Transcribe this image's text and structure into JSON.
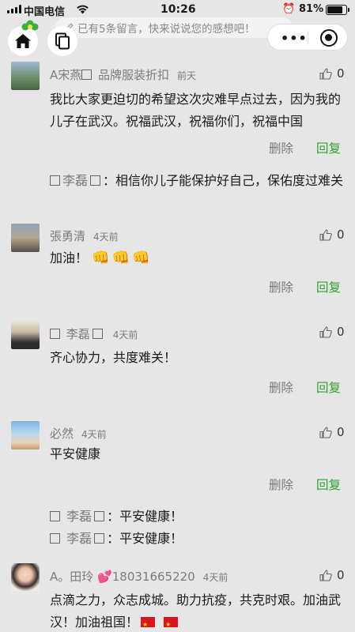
{
  "status_bar": {
    "carrier": "中国电信",
    "time": "10:26",
    "battery": "81%"
  },
  "header": {
    "message_placeholder": "已有5条留言，快来说说您的感想吧！"
  },
  "comments": [
    {
      "name": "A宋燕",
      "name_suffix": " 品牌服装折扣",
      "time": "前天",
      "likes": "0",
      "text": "我比大家更迫切的希望这次灾难早点过去，因为我的儿子在武汉。祝福武汉，祝福你们，祝福中国",
      "delete": "删除",
      "reply": "回复",
      "replies": [
        {
          "name": "李磊",
          "text": "：相信你儿子能保护好自己，保佑度过难关"
        }
      ]
    },
    {
      "name": "張勇清",
      "time": "4天前",
      "likes": "0",
      "text": "加油！",
      "emoji": "👊",
      "delete": "删除",
      "reply": "回复"
    },
    {
      "name": "李磊",
      "time": "4天前",
      "likes": "0",
      "text": "齐心协力，共度难关！",
      "delete": "删除",
      "reply": "回复"
    },
    {
      "name": "必然",
      "time": "4天前",
      "likes": "0",
      "text": "平安健康",
      "delete": "删除",
      "reply": "回复",
      "replies": [
        {
          "name": "李磊",
          "text": "：平安健康！"
        },
        {
          "name": "李磊",
          "text": "：平安健康！"
        }
      ]
    },
    {
      "name": "A。田玲",
      "name_suffix": "18031665220",
      "time": "4天前",
      "likes": "0",
      "text": "点滴之力，众志成城。助力抗疫，共克时艰。加油武汉！加油祖国！"
    }
  ]
}
